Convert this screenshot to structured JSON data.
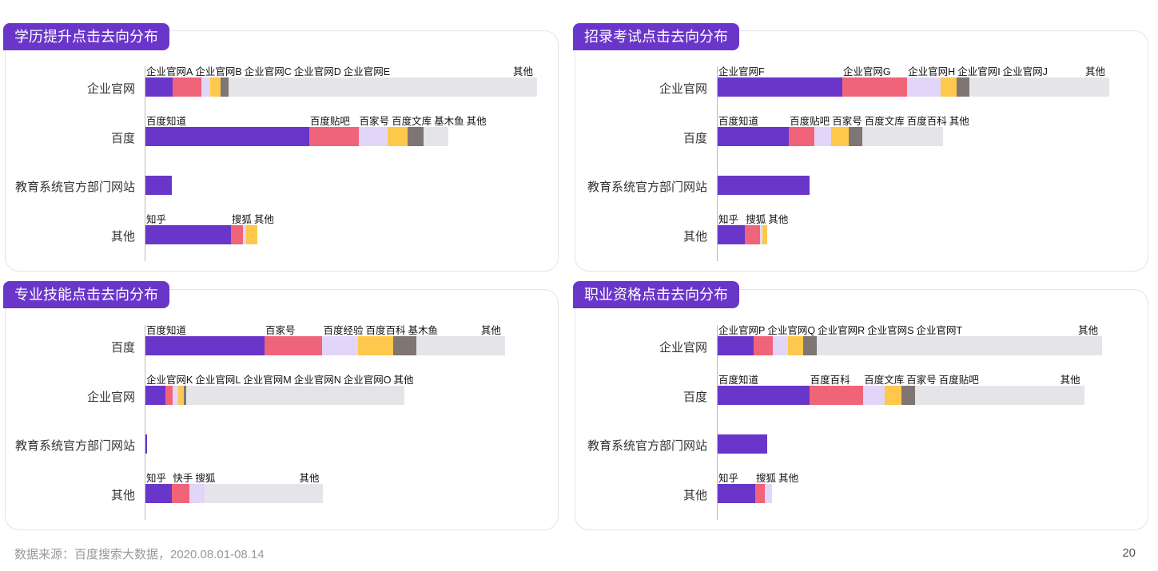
{
  "footer": {
    "source": "数据来源：百度搜索大数据，2020.08.01-08.14",
    "page": "20"
  },
  "colors": {
    "purple": "#6a36c9",
    "pink": "#f0647a",
    "lavender": "#e2d6f8",
    "yellow": "#fdc84c",
    "brown": "#7f7572",
    "grey": "#e5e5e9"
  },
  "chart_data": [
    {
      "type": "bar",
      "title": "学历提升点击去向分布",
      "stacked": true,
      "orientation": "horizontal",
      "categories": [
        "企业官网",
        "百度",
        "教育系统官方部门网站",
        "其他"
      ],
      "rows": [
        {
          "category": "企业官网",
          "segments": [
            {
              "label": "企业官网A",
              "value": 7,
              "color": "purple"
            },
            {
              "label": "企业官网B",
              "value": 7.2,
              "color": "pink"
            },
            {
              "label": "企业官网C",
              "value": 2.4,
              "color": "lavender"
            },
            {
              "label": "企业官网D",
              "value": 2.6,
              "color": "yellow"
            },
            {
              "label": "企业官网E",
              "value": 2,
              "color": "brown"
            },
            {
              "label": "其他",
              "value": 78.8,
              "color": "grey"
            }
          ]
        },
        {
          "category": "百度",
          "segments": [
            {
              "label": "百度知道",
              "value": 41.8,
              "color": "purple"
            },
            {
              "label": "百度贴吧",
              "value": 12.6,
              "color": "pink"
            },
            {
              "label": "百家号",
              "value": 7.4,
              "color": "lavender"
            },
            {
              "label": "百度文库",
              "value": 5.2,
              "color": "yellow"
            },
            {
              "label": "基木鱼",
              "value": 4,
              "color": "brown"
            },
            {
              "label": "其他",
              "value": 6.4,
              "color": "grey"
            }
          ]
        },
        {
          "category": "教育系统官方部门网站",
          "segments": [
            {
              "label": "",
              "value": 6.8,
              "color": "purple"
            }
          ]
        },
        {
          "category": "其他",
          "segments": [
            {
              "label": "知乎",
              "value": 21.8,
              "color": "purple"
            },
            {
              "label": "搜狐",
              "value": 3,
              "color": "pink"
            },
            {
              "label": "",
              "value": 1,
              "color": "lavender"
            },
            {
              "label": "其他",
              "value": 2.8,
              "color": "yellow"
            }
          ]
        }
      ]
    },
    {
      "type": "bar",
      "title": "招录考试点击去向分布",
      "stacked": true,
      "orientation": "horizontal",
      "categories": [
        "企业官网",
        "百度",
        "教育系统官方部门网站",
        "其他"
      ],
      "rows": [
        {
          "category": "企业官网",
          "segments": [
            {
              "label": "企业官网F",
              "value": 31.8,
              "color": "purple"
            },
            {
              "label": "企业官网G",
              "value": 16.6,
              "color": "pink"
            },
            {
              "label": "企业官网H",
              "value": 8.6,
              "color": "lavender"
            },
            {
              "label": "企业官网I",
              "value": 4,
              "color": "yellow"
            },
            {
              "label": "企业官网J",
              "value": 3.2,
              "color": "brown"
            },
            {
              "label": "其他",
              "value": 35.8,
              "color": "grey"
            }
          ]
        },
        {
          "category": "百度",
          "segments": [
            {
              "label": "百度知道",
              "value": 18.2,
              "color": "purple"
            },
            {
              "label": "百度贴吧",
              "value": 6.4,
              "color": "pink"
            },
            {
              "label": "百家号",
              "value": 4.4,
              "color": "lavender"
            },
            {
              "label": "百度文库",
              "value": 4.4,
              "color": "yellow"
            },
            {
              "label": "百度百科",
              "value": 3.6,
              "color": "brown"
            },
            {
              "label": "其他",
              "value": 20.6,
              "color": "grey"
            }
          ]
        },
        {
          "category": "教育系统官方部门网站",
          "segments": [
            {
              "label": "",
              "value": 23.4,
              "color": "purple"
            }
          ]
        },
        {
          "category": "其他",
          "segments": [
            {
              "label": "知乎",
              "value": 7,
              "color": "purple"
            },
            {
              "label": "搜狐",
              "value": 3.8,
              "color": "pink"
            },
            {
              "label": "",
              "value": 0.6,
              "color": "lavender"
            },
            {
              "label": "其他",
              "value": 1.2,
              "color": "yellow"
            }
          ]
        }
      ]
    },
    {
      "type": "bar",
      "title": "专业技能点击去向分布",
      "stacked": true,
      "orientation": "horizontal",
      "categories": [
        "百度",
        "企业官网",
        "教育系统官方部门网站",
        "其他"
      ],
      "rows": [
        {
          "category": "百度",
          "segments": [
            {
              "label": "百度知道",
              "value": 30.4,
              "color": "purple"
            },
            {
              "label": "百家号",
              "value": 14.8,
              "color": "pink"
            },
            {
              "label": "百度经验",
              "value": 9,
              "color": "lavender"
            },
            {
              "label": "百度百科",
              "value": 9,
              "color": "yellow"
            },
            {
              "label": "基木鱼",
              "value": 6,
              "color": "brown"
            },
            {
              "label": "其他",
              "value": 22.6,
              "color": "grey"
            }
          ]
        },
        {
          "category": "企业官网",
          "segments": [
            {
              "label": "企业官网K",
              "value": 5,
              "color": "purple"
            },
            {
              "label": "企业官网L",
              "value": 2,
              "color": "pink"
            },
            {
              "label": "企业官网M",
              "value": 1.4,
              "color": "lavender"
            },
            {
              "label": "企业官网N",
              "value": 1.4,
              "color": "yellow"
            },
            {
              "label": "企业官网O",
              "value": 0.6,
              "color": "brown"
            },
            {
              "label": "其他",
              "value": 55.8,
              "color": "grey"
            }
          ]
        },
        {
          "category": "教育系统官方部门网站",
          "segments": [
            {
              "label": "",
              "value": 0.4,
              "color": "purple"
            }
          ]
        },
        {
          "category": "其他",
          "segments": [
            {
              "label": "知乎",
              "value": 6.8,
              "color": "purple"
            },
            {
              "label": "快手",
              "value": 4.4,
              "color": "pink"
            },
            {
              "label": "搜狐",
              "value": 4,
              "color": "lavender"
            },
            {
              "label": "其他",
              "value": 30.2,
              "color": "grey"
            }
          ]
        }
      ]
    },
    {
      "type": "bar",
      "title": "职业资格点击去向分布",
      "stacked": true,
      "orientation": "horizontal",
      "categories": [
        "企业官网",
        "百度",
        "教育系统官方部门网站",
        "其他"
      ],
      "rows": [
        {
          "category": "企业官网",
          "segments": [
            {
              "label": "企业官网P",
              "value": 9.2,
              "color": "purple"
            },
            {
              "label": "企业官网Q",
              "value": 4.8,
              "color": "pink"
            },
            {
              "label": "企业官网R",
              "value": 4,
              "color": "lavender"
            },
            {
              "label": "企业官网S",
              "value": 3.8,
              "color": "yellow"
            },
            {
              "label": "企业官网T",
              "value": 3.6,
              "color": "brown"
            },
            {
              "label": "其他",
              "value": 72.8,
              "color": "grey"
            }
          ]
        },
        {
          "category": "百度",
          "segments": [
            {
              "label": "百度知道",
              "value": 23.4,
              "color": "purple"
            },
            {
              "label": "百度百科",
              "value": 13.8,
              "color": "pink"
            },
            {
              "label": "百度文库",
              "value": 5.4,
              "color": "lavender"
            },
            {
              "label": "百家号",
              "value": 4.4,
              "color": "yellow"
            },
            {
              "label": "百度贴吧",
              "value": 3.4,
              "color": "brown"
            },
            {
              "label": "其他",
              "value": 43.2,
              "color": "grey"
            }
          ]
        },
        {
          "category": "教育系统官方部门网站",
          "segments": [
            {
              "label": "",
              "value": 12.6,
              "color": "purple"
            }
          ]
        },
        {
          "category": "其他",
          "segments": [
            {
              "label": "知乎",
              "value": 9.6,
              "color": "purple"
            },
            {
              "label": "搜狐",
              "value": 2.4,
              "color": "pink"
            },
            {
              "label": "其他",
              "value": 1.8,
              "color": "lavender"
            }
          ]
        }
      ]
    }
  ]
}
